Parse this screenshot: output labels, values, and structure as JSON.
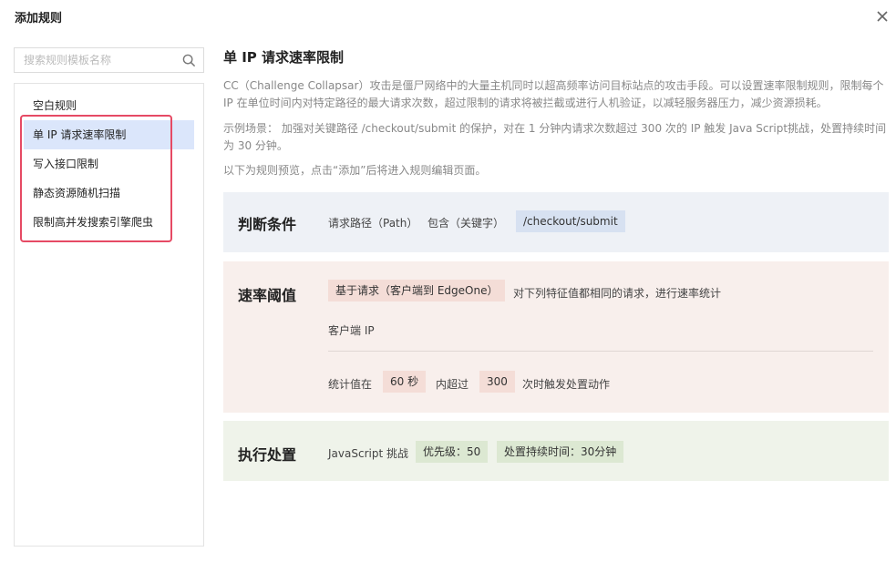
{
  "dialog": {
    "title": "添加规则"
  },
  "search": {
    "placeholder": "搜索规则模板名称"
  },
  "templates": [
    {
      "label": "空白规则"
    },
    {
      "label": "单 IP 请求速率限制"
    },
    {
      "label": "写入接口限制"
    },
    {
      "label": "静态资源随机扫描"
    },
    {
      "label": "限制高并发搜索引擎爬虫"
    }
  ],
  "selected_template_index": 1,
  "detail": {
    "title": "单 IP 请求速率限制",
    "desc_1": "CC（Challenge Collapsar）攻击是僵尸网络中的大量主机同时以超高频率访问目标站点的攻击手段。可以设置速率限制规则，限制每个 IP 在单位时间内对特定路径的最大请求次数，超过限制的请求将被拦截或进行人机验证，以减轻服务器压力，减少资源损耗。",
    "desc_2": "示例场景： 加强对关键路径 /checkout/submit 的保护，对在 1 分钟内请求次数超过 300 次的 IP 触发 Java Script挑战，处置持续时间为 30 分钟。",
    "desc_3": "以下为规则预览，点击“添加”后将进入规则编辑页面。"
  },
  "condition": {
    "label": "判断条件",
    "field": "请求路径（Path）",
    "operator": "包含（关键字）",
    "value": "/checkout/submit"
  },
  "rate": {
    "label": "速率阈值",
    "basis": "基于请求（客户端到 EdgeOne）",
    "basis_desc": "对下列特征值都相同的请求，进行速率统计",
    "feature": "客户端 IP",
    "stat_prefix": "统计值在",
    "period": "60 秒",
    "stat_mid": "内超过",
    "count": "300",
    "stat_suffix": "次时触发处置动作"
  },
  "action": {
    "label": "执行处置",
    "type": "JavaScript 挑战",
    "priority": "优先级：50",
    "duration": "处置持续时间：30分钟"
  },
  "colors": {
    "selected_bg": "#dbe6fb",
    "highlight_border": "#e64a64",
    "condition_bg": "#eef1f6",
    "condition_tag": "#d7e1f1",
    "rate_bg": "#f8efec",
    "rate_tag": "#f4ddd7",
    "action_bg": "#eff3ea",
    "action_tag": "#dce8d2"
  }
}
